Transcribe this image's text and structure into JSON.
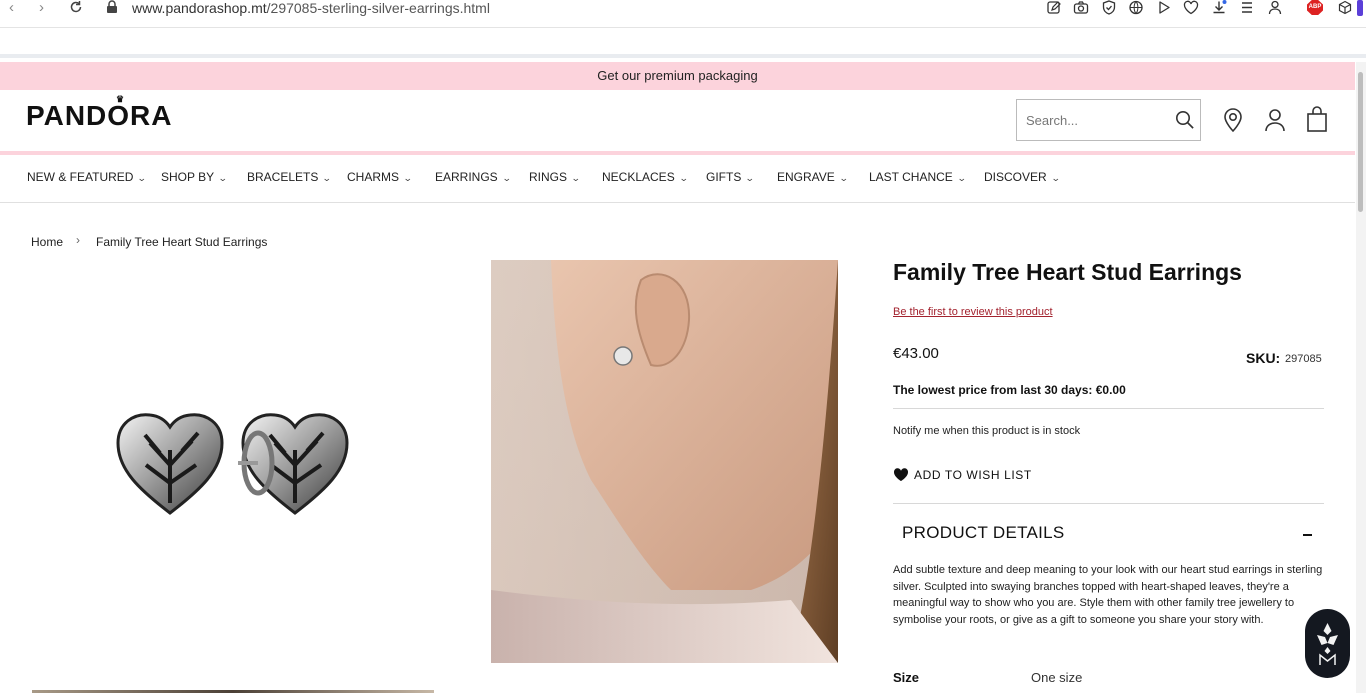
{
  "browser": {
    "back_icon": "chevron-left-icon",
    "forward_icon": "chevron-right-icon",
    "reload_icon": "reload-icon",
    "url_host": "www.pandorashop.mt",
    "url_path": "/297085-sterling-silver-earrings.html",
    "extension_icons": [
      "edit-icon",
      "camera-icon",
      "shield-icon",
      "globe-icon",
      "play-icon",
      "heart-icon",
      "download-icon",
      "list-icon",
      "user-icon",
      "abp-icon",
      "cube-icon"
    ],
    "abp_label": "ABP"
  },
  "promo": {
    "text": "Get our premium packaging"
  },
  "header": {
    "logo": "PANDORA",
    "search_placeholder": "Search..."
  },
  "menu": [
    "NEW & FEATURED",
    "SHOP BY",
    "BRACELETS",
    "CHARMS",
    "EARRINGS",
    "RINGS",
    "NECKLACES",
    "GIFTS",
    "ENGRAVE",
    "LAST CHANCE",
    "DISCOVER"
  ],
  "breadcrumb": {
    "home": "Home",
    "current": "Family Tree Heart Stud Earrings"
  },
  "product": {
    "title": "Family Tree Heart Stud Earrings",
    "review_link": "Be the first to review this product",
    "price": "€43.00",
    "sku_label": "SKU:",
    "sku_value": "297085",
    "lowest_price": "The lowest price from last 30 days: €0.00",
    "notify": "Notify me when this product is in stock",
    "wish_list": "ADD TO WISH LIST",
    "details_heading": "PRODUCT DETAILS",
    "description": "Add subtle texture and deep meaning to your look with our heart stud earrings in sterling silver. Sculpted into swaying branches topped with heart-shaped leaves, they're a meaningful way to show who you are. Style them with other family tree jewellery to symbolise your roots, or give as a gift to someone you share your story with.",
    "size_label": "Size",
    "size_value": "One size"
  },
  "colors": {
    "promo_pink": "#fcd3dc",
    "review_red": "#a3232f",
    "chat_dark": "#141820"
  }
}
